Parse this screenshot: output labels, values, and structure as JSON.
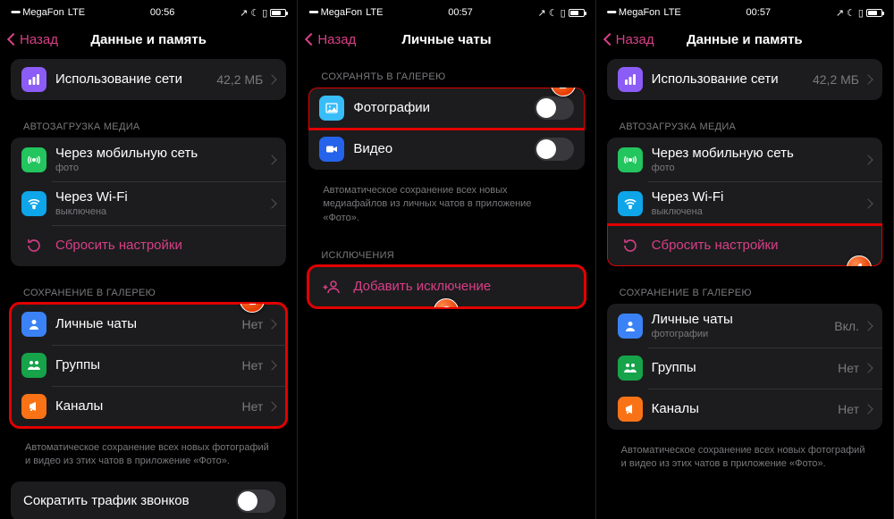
{
  "status": {
    "carrier": "MegaFon",
    "network": "LTE",
    "time1": "00:56",
    "time2": "00:57",
    "time3": "00:57"
  },
  "nav": {
    "back": "Назад",
    "title_data": "Данные и память",
    "title_private": "Личные чаты"
  },
  "screen1": {
    "usage": {
      "label": "Использование сети",
      "value": "42,2 МБ"
    },
    "section_media": "АВТОЗАГРУЗКА МЕДИА",
    "mobile": {
      "label": "Через мобильную сеть",
      "sub": "фото"
    },
    "wifi": {
      "label": "Через Wi-Fi",
      "sub": "выключена"
    },
    "reset": "Сбросить настройки",
    "section_gallery": "СОХРАНЕНИЕ В ГАЛЕРЕЮ",
    "private": {
      "label": "Личные чаты",
      "value": "Нет"
    },
    "groups": {
      "label": "Группы",
      "value": "Нет"
    },
    "channels": {
      "label": "Каналы",
      "value": "Нет"
    },
    "footer": "Автоматическое сохранение всех новых фотографий и видео из этих чатов в приложение «Фото».",
    "calls": "Сократить трафик звонков"
  },
  "screen2": {
    "section_save": "СОХРАНЯТЬ В ГАЛЕРЕЮ",
    "photo": "Фотографии",
    "video": "Видео",
    "footer1": "Автоматическое сохранение всех новых медиафайлов из личных чатов в приложение «Фото».",
    "section_exc": "ИСКЛЮЧЕНИЯ",
    "add_exc": "Добавить исключение"
  },
  "screen3": {
    "private": {
      "label": "Личные чаты",
      "sub": "фотографии",
      "value": "Вкл."
    },
    "groups": {
      "label": "Группы",
      "value": "Нет"
    },
    "channels": {
      "label": "Каналы",
      "value": "Нет"
    }
  }
}
